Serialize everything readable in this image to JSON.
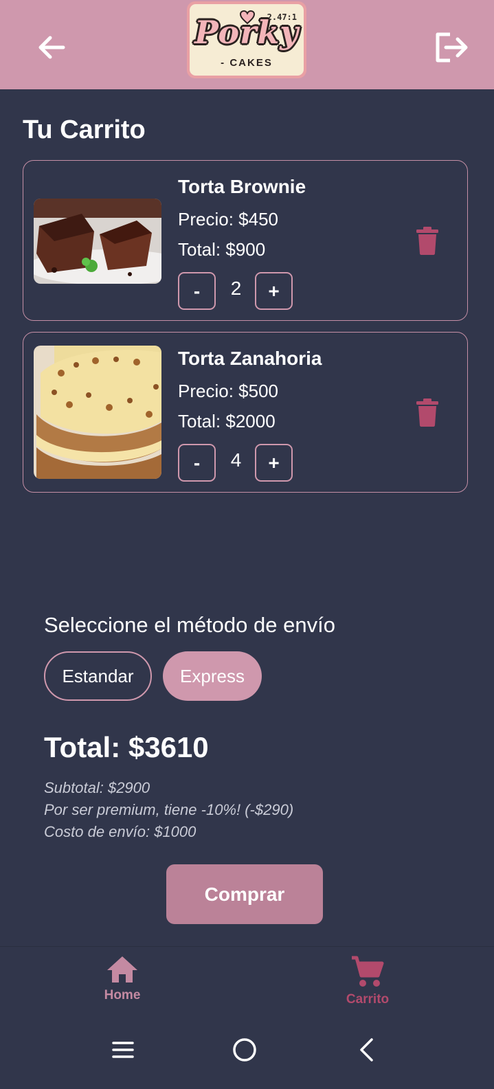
{
  "colors": {
    "header": "#cf98ad",
    "background": "#31364b",
    "accent": "#cf98ad",
    "trash": "#b24a6c",
    "buy_button": "#bb8298",
    "nav_home": "#c48aa2",
    "nav_cart": "#b24a6c"
  },
  "header": {
    "back_icon": "arrow-left-icon",
    "logout_icon": "logout-icon",
    "logo": {
      "word": "Porky",
      "sub": "- CAKES",
      "version": "2.47:1"
    }
  },
  "page_title": "Tu Carrito",
  "cart": {
    "items": [
      {
        "name": "Torta Brownie",
        "price": "Precio: $450",
        "total": "Total: $900",
        "minus": "-",
        "qty": "2",
        "plus": "+",
        "image": "brownie-cake-photo"
      },
      {
        "name": "Torta Zanahoria",
        "price": "Precio: $500",
        "total": "Total: $2000",
        "minus": "-",
        "qty": "4",
        "plus": "+",
        "image": "carrot-cake-photo"
      }
    ]
  },
  "shipping": {
    "title": "Seleccione el método de envío",
    "options": [
      {
        "label": "Estandar",
        "selected": false
      },
      {
        "label": "Express",
        "selected": true
      }
    ]
  },
  "summary": {
    "total": "Total: $3610",
    "subtotal": "Subtotal: $2900",
    "discount": "Por ser premium, tiene -10%! (-$290)",
    "shipping_cost": "Costo de envío: $1000"
  },
  "buy_label": "Comprar",
  "bottom_nav": {
    "home": {
      "label": "Home",
      "icon": "home-icon"
    },
    "cart": {
      "label": "Carrito",
      "icon": "cart-icon",
      "active": true
    }
  },
  "system_nav": {
    "menu_icon": "menu-icon",
    "home_icon": "circle-home-icon",
    "back_icon": "chevron-left-icon"
  }
}
